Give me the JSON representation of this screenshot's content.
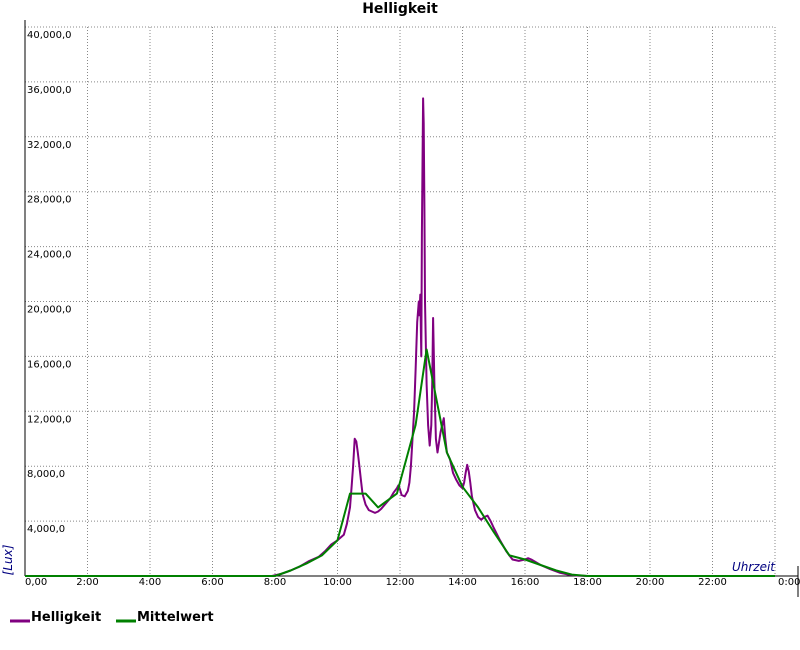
{
  "chart_data": {
    "type": "line",
    "title": "Helligkeit",
    "xlabel": "Uhrzeit",
    "ylabel": "[Lux]",
    "xlim": [
      0,
      24
    ],
    "ylim": [
      0,
      40000
    ],
    "grid": true,
    "legend_position": "bottom-left",
    "colors": {
      "axis_label": "#000080",
      "grid": "#888888"
    },
    "x_ticks": [
      {
        "value": 0,
        "label": "0,00"
      },
      {
        "value": 2,
        "label": "2:00"
      },
      {
        "value": 4,
        "label": "4:00"
      },
      {
        "value": 6,
        "label": "6:00"
      },
      {
        "value": 8,
        "label": "8:00"
      },
      {
        "value": 10,
        "label": "10:00"
      },
      {
        "value": 12,
        "label": "12:00"
      },
      {
        "value": 14,
        "label": "14:00"
      },
      {
        "value": 16,
        "label": "16:00"
      },
      {
        "value": 18,
        "label": "18:00"
      },
      {
        "value": 20,
        "label": "20:00"
      },
      {
        "value": 22,
        "label": "22:00"
      },
      {
        "value": 24,
        "label": "0:00"
      }
    ],
    "y_ticks": [
      {
        "value": 0,
        "label": "0,00"
      },
      {
        "value": 4000,
        "label": "4,000,0"
      },
      {
        "value": 8000,
        "label": "8,000,0"
      },
      {
        "value": 12000,
        "label": "12,000,0"
      },
      {
        "value": 16000,
        "label": "16,000,0"
      },
      {
        "value": 20000,
        "label": "20,000,0"
      },
      {
        "value": 24000,
        "label": "24,000,0"
      },
      {
        "value": 28000,
        "label": "28,000,0"
      },
      {
        "value": 32000,
        "label": "32,000,0"
      },
      {
        "value": 36000,
        "label": "36,000,0"
      },
      {
        "value": 40000,
        "label": "40,000,0"
      }
    ],
    "series": [
      {
        "name": "Helligkeit",
        "color": "#800080",
        "points": [
          [
            0,
            0
          ],
          [
            7.9,
            0
          ],
          [
            8.2,
            150
          ],
          [
            8.5,
            400
          ],
          [
            8.8,
            700
          ],
          [
            9.1,
            1100
          ],
          [
            9.4,
            1400
          ],
          [
            9.6,
            1800
          ],
          [
            9.8,
            2300
          ],
          [
            10.0,
            2600
          ],
          [
            10.2,
            3000
          ],
          [
            10.3,
            3800
          ],
          [
            10.4,
            5000
          ],
          [
            10.45,
            6500
          ],
          [
            10.5,
            8000
          ],
          [
            10.55,
            10000
          ],
          [
            10.6,
            9800
          ],
          [
            10.65,
            9000
          ],
          [
            10.7,
            8000
          ],
          [
            10.75,
            7000
          ],
          [
            10.8,
            6000
          ],
          [
            10.9,
            5200
          ],
          [
            11.0,
            4800
          ],
          [
            11.1,
            4700
          ],
          [
            11.2,
            4600
          ],
          [
            11.3,
            4700
          ],
          [
            11.4,
            4900
          ],
          [
            11.55,
            5300
          ],
          [
            11.7,
            5700
          ],
          [
            11.8,
            6100
          ],
          [
            11.9,
            6400
          ],
          [
            11.95,
            6600
          ],
          [
            12.0,
            6300
          ],
          [
            12.05,
            5900
          ],
          [
            12.15,
            5800
          ],
          [
            12.25,
            6200
          ],
          [
            12.3,
            6800
          ],
          [
            12.35,
            8000
          ],
          [
            12.4,
            10000
          ],
          [
            12.45,
            12000
          ],
          [
            12.5,
            15000
          ],
          [
            12.55,
            18500
          ],
          [
            12.6,
            20000
          ],
          [
            12.62,
            19000
          ],
          [
            12.65,
            20500
          ],
          [
            12.68,
            16000
          ],
          [
            12.7,
            25000
          ],
          [
            12.72,
            30000
          ],
          [
            12.74,
            34800
          ],
          [
            12.76,
            33000
          ],
          [
            12.78,
            27000
          ],
          [
            12.8,
            20000
          ],
          [
            12.85,
            14000
          ],
          [
            12.9,
            11000
          ],
          [
            12.95,
            9500
          ],
          [
            13.0,
            11000
          ],
          [
            13.03,
            14000
          ],
          [
            13.06,
            18800
          ],
          [
            13.1,
            14000
          ],
          [
            13.15,
            10000
          ],
          [
            13.2,
            9000
          ],
          [
            13.3,
            10500
          ],
          [
            13.4,
            11500
          ],
          [
            13.45,
            10000
          ],
          [
            13.5,
            9000
          ],
          [
            13.6,
            8500
          ],
          [
            13.7,
            7500
          ],
          [
            13.8,
            7000
          ],
          [
            13.9,
            6600
          ],
          [
            14.0,
            6400
          ],
          [
            14.05,
            6800
          ],
          [
            14.1,
            7500
          ],
          [
            14.15,
            8100
          ],
          [
            14.2,
            7600
          ],
          [
            14.25,
            6800
          ],
          [
            14.3,
            5800
          ],
          [
            14.4,
            4800
          ],
          [
            14.5,
            4300
          ],
          [
            14.6,
            4100
          ],
          [
            14.7,
            4300
          ],
          [
            14.8,
            4400
          ],
          [
            14.9,
            4000
          ],
          [
            15.0,
            3500
          ],
          [
            15.2,
            2600
          ],
          [
            15.4,
            1800
          ],
          [
            15.6,
            1200
          ],
          [
            15.8,
            1100
          ],
          [
            16.0,
            1200
          ],
          [
            16.1,
            1300
          ],
          [
            16.2,
            1200
          ],
          [
            16.5,
            800
          ],
          [
            16.8,
            500
          ],
          [
            17.1,
            250
          ],
          [
            17.4,
            100
          ],
          [
            17.7,
            30
          ],
          [
            18.0,
            0
          ],
          [
            24,
            0
          ]
        ]
      },
      {
        "name": "Mittelwert",
        "color": "#008000",
        "points": [
          [
            0,
            0
          ],
          [
            8.0,
            0
          ],
          [
            8.5,
            400
          ],
          [
            9.0,
            900
          ],
          [
            9.5,
            1500
          ],
          [
            10.0,
            2600
          ],
          [
            10.4,
            6000
          ],
          [
            10.9,
            6000
          ],
          [
            11.3,
            5000
          ],
          [
            11.9,
            6000
          ],
          [
            12.5,
            11000
          ],
          [
            12.85,
            16500
          ],
          [
            13.5,
            9000
          ],
          [
            14.0,
            6500
          ],
          [
            14.5,
            5000
          ],
          [
            15.0,
            3200
          ],
          [
            15.5,
            1500
          ],
          [
            16.0,
            1200
          ],
          [
            16.5,
            800
          ],
          [
            17.0,
            400
          ],
          [
            17.5,
            100
          ],
          [
            18.0,
            0
          ],
          [
            24,
            0
          ]
        ]
      }
    ]
  }
}
